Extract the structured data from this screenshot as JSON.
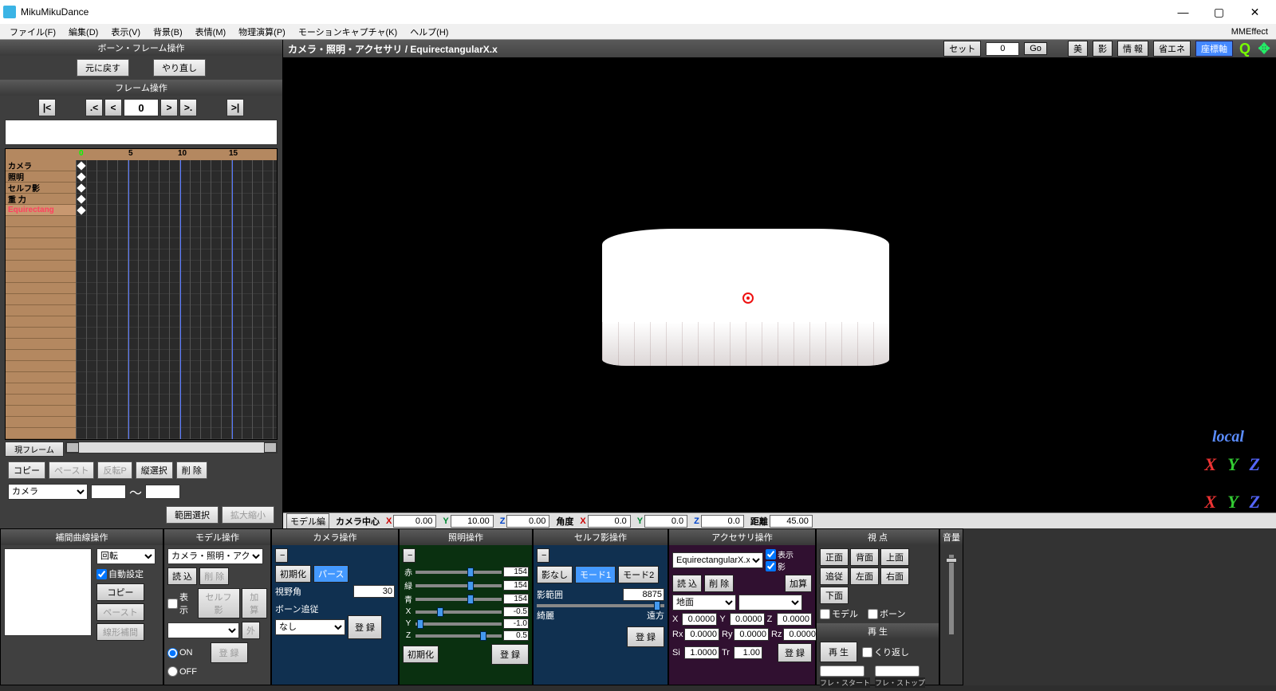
{
  "title": "MikuMikuDance",
  "menus": [
    "ファイル(F)",
    "編集(D)",
    "表示(V)",
    "背景(B)",
    "表情(M)",
    "物理演算(P)",
    "モーションキャプチャ(K)",
    "ヘルプ(H)"
  ],
  "mme_label": "MMEffect",
  "bone_panel": {
    "title": "ボーン・フレーム操作",
    "undo": "元に戻す",
    "redo": "やり直し"
  },
  "frame_panel": {
    "title": "フレーム操作",
    "value": "0"
  },
  "timeline": {
    "ruler": [
      "0",
      "5",
      "10",
      "15"
    ],
    "tracks": [
      "カメラ",
      "照明",
      "セルフ影",
      "重 力",
      "Equirectang"
    ],
    "current_btn": "現フレーム"
  },
  "edit": {
    "copy": "コピー",
    "paste": "ペースト",
    "flip": "反転P",
    "vsel": "縦選択",
    "del": "削 除",
    "range": "範囲選択",
    "zoom": "拡大縮小"
  },
  "combo_camera": "カメラ",
  "vp": {
    "title": "カメラ・照明・アクセサリ  /  EquirectangularX.x",
    "set": "セット",
    "go": "Go",
    "frame": "0",
    "b1": "美",
    "b2": "影",
    "b3": "情 報",
    "b4": "省エネ",
    "b5": "座標軸",
    "gizmo_label": "local"
  },
  "status": {
    "model_btn": "モデル編",
    "cam_center": "カメラ中心",
    "x": "0.00",
    "y": "10.00",
    "z": "0.00",
    "angle": "角度",
    "ax": "0.0",
    "ay": "0.0",
    "az": "0.0",
    "dist_lbl": "距離",
    "dist": "45.00"
  },
  "curve": {
    "title": "補間曲線操作",
    "mode": "回転",
    "auto": "自動設定",
    "copy": "コピー",
    "paste": "ペースト",
    "line": "線形補間"
  },
  "modelp": {
    "title": "モデル操作",
    "combo": "カメラ・照明・アクセサリ",
    "read": "読 込",
    "del": "削 除",
    "show": "表示",
    "self": "セルフ影",
    "add": "加算",
    "ext": "外",
    "on": "ON",
    "off": "OFF",
    "reg": "登 録"
  },
  "camp": {
    "title": "カメラ操作",
    "init": "初期化",
    "persp": "パース",
    "fov_lbl": "視野角",
    "fov": "30",
    "bone_lbl": "ボーン追従",
    "bone": "なし",
    "reg": "登 録"
  },
  "lightp": {
    "title": "照明操作",
    "r_lbl": "赤",
    "g_lbl": "緑",
    "b_lbl": "青",
    "r": "154",
    "g": "154",
    "b": "154",
    "x": "-0.5",
    "y": "-1.0",
    "z": "0.5",
    "init": "初期化",
    "reg": "登 録"
  },
  "shadowp": {
    "title": "セルフ影操作",
    "none": "影なし",
    "m1": "モード1",
    "m2": "モード2",
    "range_lbl": "影範囲",
    "range": "8875",
    "over": "綺麗",
    "far": "遠方",
    "reg": "登 録"
  },
  "accp": {
    "title": "アクセサリ操作",
    "combo": "EquirectangularX.x",
    "show": "表示",
    "shadow": "影",
    "read": "読 込",
    "del": "削 除",
    "add": "加算",
    "ground": "地面",
    "x": "0.0000",
    "y": "0.0000",
    "z": "0.0000",
    "rx": "0.0000",
    "ry": "0.0000",
    "rz": "0.0000",
    "si": "1.0000",
    "tr": "1.00",
    "reg": "登 録"
  },
  "viewp": {
    "title": "視 点",
    "front": "正面",
    "back": "背面",
    "top": "上面",
    "left": "左面",
    "right": "右面",
    "bottom": "下面",
    "follow": "追従",
    "model": "モデル",
    "bone": "ボーン",
    "play_title": "再 生",
    "play": "再 生",
    "loop": "くり返し",
    "fstart": "フレ・スタート",
    "fstop": "フレ・ストップ"
  },
  "vol": {
    "title": "音量"
  }
}
